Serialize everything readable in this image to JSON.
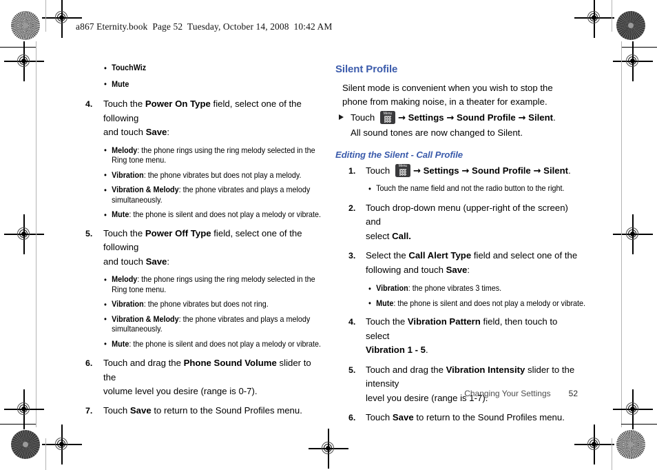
{
  "header": {
    "text": "a867 Eternity.book  Page 52  Tuesday, October 14, 2008  10:42 AM"
  },
  "icons": {
    "menu_key_label": "Menu",
    "arrow": "→",
    "triangle_bullet": "►"
  },
  "colors": {
    "heading_blue": "#3b5bab",
    "body_black": "#000000",
    "footer_gray": "#4c4c4c",
    "menu_key_dark": "#3a3a3c"
  },
  "left_column": {
    "bullets_top": [
      {
        "term": "TouchWiz",
        "rest": ""
      },
      {
        "term": "Mute",
        "rest": ""
      }
    ],
    "step4": {
      "num": "4.",
      "line1_pre": "Touch the ",
      "line1_bold": "Power On Type",
      "line1_post": " field, select one of the following",
      "line2_pre": "and touch ",
      "line2_bold": "Save",
      "line2_post": ":"
    },
    "step4_bullets": [
      {
        "term": "Melody",
        "rest": ": the phone rings using the ring melody selected in the Ring tone menu."
      },
      {
        "term": "Vibration",
        "rest": ": the phone vibrates but does not play a melody."
      },
      {
        "term": "Vibration & Melody",
        "rest": ": the phone vibrates and plays a melody simultaneously."
      },
      {
        "term": "Mute",
        "rest": ": the phone is silent and does not play a melody or vibrate."
      }
    ],
    "step5": {
      "num": "5.",
      "line1_pre": "Touch the ",
      "line1_bold": "Power Off Type",
      "line1_post": " field, select one of the following",
      "line2_pre": "and touch ",
      "line2_bold": "Save",
      "line2_post": ":"
    },
    "step5_bullets": [
      {
        "term": "Melody",
        "rest": ": the phone rings using the ring melody selected in the Ring tone menu."
      },
      {
        "term": "Vibration",
        "rest": ": the phone vibrates but does not ring."
      },
      {
        "term": "Vibration & Melody",
        "rest": ": the phone vibrates and plays a melody simultaneously."
      },
      {
        "term": "Mute",
        "rest": ": the phone is silent and does not play a melody or vibrate."
      }
    ],
    "step6": {
      "num": "6.",
      "line1_pre": "Touch and drag the ",
      "line1_bold": "Phone Sound Volume",
      "line1_post": " slider to the",
      "line2": "volume level you desire (range is 0-7)."
    },
    "step7": {
      "num": "7.",
      "pre": "Touch ",
      "bold": "Save",
      "post": " to return to the Sound Profiles menu."
    }
  },
  "right_column": {
    "section_heading": "Silent Profile",
    "intro": "Silent mode is convenient when you wish to stop the phone from making noise, in a theater for example.",
    "touch_path": {
      "pre": "Touch ",
      "seg1": "Settings",
      "seg2": "Sound Profile",
      "seg3": "Silent",
      "period": "."
    },
    "touch_path_note": "All sound tones are now changed to Silent.",
    "sub_heading": "Editing the Silent - Call Profile",
    "step1": {
      "num": "1.",
      "pre": "Touch ",
      "seg1": "Settings",
      "seg2": "Sound Profile",
      "seg3": "Silent",
      "period": "."
    },
    "step1_bullet": {
      "term": "",
      "rest": "Touch the name field and not the radio button to the right."
    },
    "step2": {
      "num": "2.",
      "line1": "Touch drop-down menu (upper-right of the screen) and",
      "line2_pre": "select ",
      "line2_bold": "Call."
    },
    "step3": {
      "num": "3.",
      "line1_pre": "Select the ",
      "line1_bold": "Call Alert Type",
      "line1_post": " field and select one of the",
      "line2_pre": "following and touch ",
      "line2_bold": "Save",
      "line2_post": ":"
    },
    "step3_bullets": [
      {
        "term": "Vibration",
        "rest": ": the phone vibrates 3 times."
      },
      {
        "term": "Mute",
        "rest": ": the phone is silent and does not play a melody or vibrate."
      }
    ],
    "step4": {
      "num": "4.",
      "line1_pre": "Touch the ",
      "line1_bold": "Vibration Pattern",
      "line1_post": " field, then touch to select",
      "line2_bold": "Vibration 1 - 5",
      "line2_post": "."
    },
    "step5": {
      "num": "5.",
      "line1_pre": "Touch and drag the ",
      "line1_bold": "Vibration Intensity",
      "line1_post": " slider to the intensity",
      "line2": "level you desire (range is 1-7)."
    },
    "step6": {
      "num": "6.",
      "pre": "Touch ",
      "bold": "Save",
      "post": " to return to the Sound Profiles menu."
    }
  },
  "footer": {
    "chapter": "Changing Your Settings",
    "page_number": "52"
  }
}
